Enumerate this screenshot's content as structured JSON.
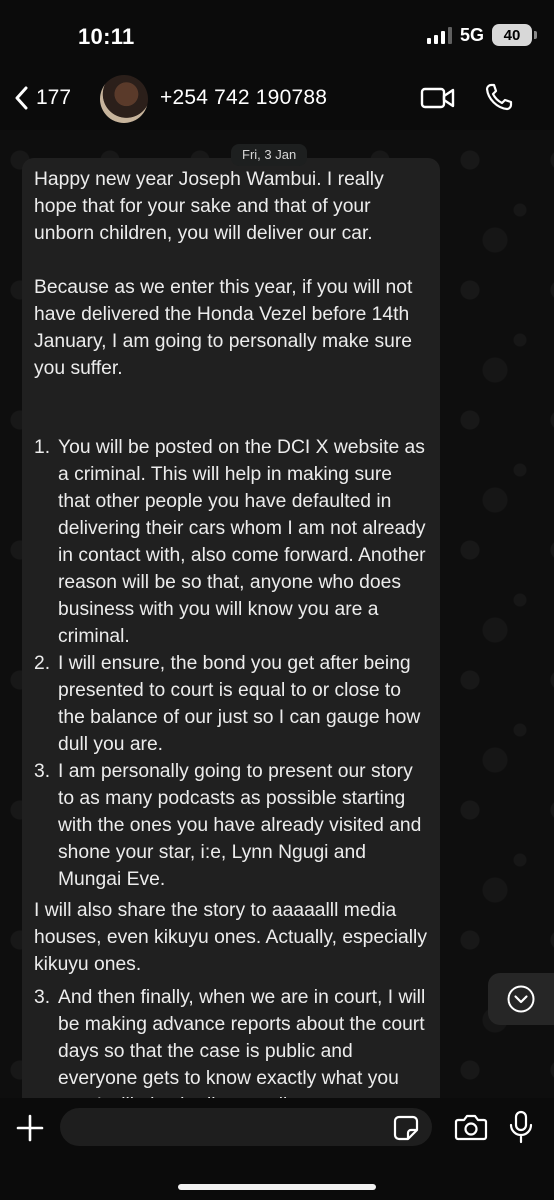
{
  "status": {
    "time": "10:11",
    "network": "5G",
    "battery": "40"
  },
  "header": {
    "back_count": "177",
    "contact": "+254 742 190788"
  },
  "chat": {
    "date": "Fri, 3 Jan",
    "message": {
      "p1": "Happy new year Joseph Wambui. I really hope that for your sake and that of your unborn children, you will deliver our car.",
      "p2": "Because as we enter this year, if you will not have delivered the Honda Vezel before 14th January, I am going to personally make sure you suffer.",
      "list1": [
        {
          "num": "1.",
          "text": "You will be posted on the DCI X website as a criminal. This will help in making sure that other people you have defaulted in delivering their cars whom I am not already in contact with, also come forward. Another reason will be so that, anyone who does business with you will know you are a criminal."
        },
        {
          "num": "2.",
          "text": "I will ensure, the bond you get after being presented to court is equal to or close to the balance of our just so I can gauge how dull you are."
        },
        {
          "num": "3.",
          "text": "I am personally going to present our story to as many podcasts as possible starting with the ones you have already visited and shone your star, i:e, Lynn Ngugi and Mungai Eve."
        }
      ],
      "p3": "I will also share the story to aaaaalll media houses, even kikuyu ones. Actually, especially kikuyu ones.",
      "list2": [
        {
          "num": "3.",
          "text": "And then finally, when we are in court, I will be making advance reports about the court days so that the case is public and everyone gets to know exactly what you are. I will also be live on all my"
        }
      ]
    }
  },
  "composer": {
    "value": ""
  },
  "icons": {
    "back": "chevron-left-icon",
    "video": "video-call-icon",
    "phone": "phone-icon",
    "scroll": "chevron-down-circle-icon",
    "plus": "plus-icon",
    "sticker": "sticker-icon",
    "camera": "camera-icon",
    "mic": "microphone-icon"
  }
}
